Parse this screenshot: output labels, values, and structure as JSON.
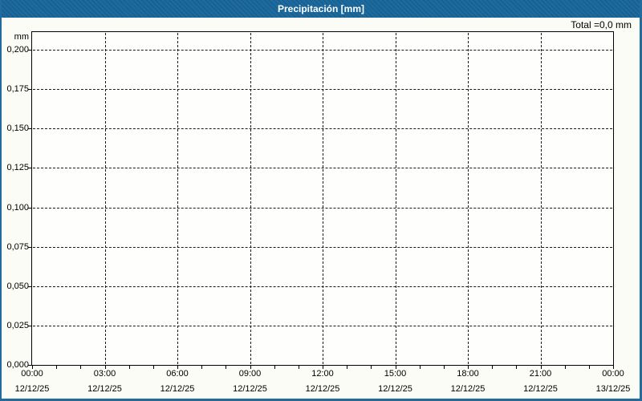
{
  "window": {
    "title": "Precipitación [mm]"
  },
  "summary": {
    "total_label": "Total =0,0 mm"
  },
  "colors": {
    "frame_blue": "#1d6b9e",
    "plot_border": "#000000",
    "grid": "#1a1a1a",
    "background": "#fbfcf5",
    "plot_background": "#fefefd",
    "title_text": "#ffffff",
    "label_text": "#000000"
  },
  "chart_data": {
    "type": "line",
    "title": "Precipitación [mm]",
    "subtitle": "",
    "xlabel": "",
    "ylabel": "",
    "y_axis": {
      "unit": "mm",
      "tick_labels": [
        "0,200",
        "0,175",
        "0,150",
        "0,125",
        "0,100",
        "0,075",
        "0,050",
        "0,025",
        "0,000"
      ],
      "tick_values": [
        0.2,
        0.175,
        0.15,
        0.125,
        0.1,
        0.075,
        0.05,
        0.025,
        0.0
      ],
      "lim": [
        0,
        0.2
      ],
      "decimal_separator": ","
    },
    "x_axis": {
      "major_ticks": [
        {
          "time": "00:00",
          "date": "12/12/25"
        },
        {
          "time": "03:00",
          "date": "12/12/25"
        },
        {
          "time": "06:00",
          "date": "12/12/25"
        },
        {
          "time": "09:00",
          "date": "12/12/25"
        },
        {
          "time": "12:00",
          "date": "12/12/25"
        },
        {
          "time": "15:00",
          "date": "12/12/25"
        },
        {
          "time": "18:00",
          "date": "12/12/25"
        },
        {
          "time": "21:00",
          "date": "12/12/25"
        },
        {
          "time": "00:00",
          "date": "13/12/25"
        }
      ],
      "minor_ticks_per_major_interval": 3,
      "range_hours": 24
    },
    "series": [
      {
        "name": "Precipitación",
        "unit": "mm",
        "values": [],
        "total": 0.0,
        "total_display": "Total =0,0 mm"
      }
    ],
    "grid": {
      "enabled": true,
      "style": "dashed"
    },
    "legend": {
      "visible": false
    },
    "annotations": [
      {
        "text": "Total =0,0 mm",
        "position": "top-right"
      }
    ]
  }
}
